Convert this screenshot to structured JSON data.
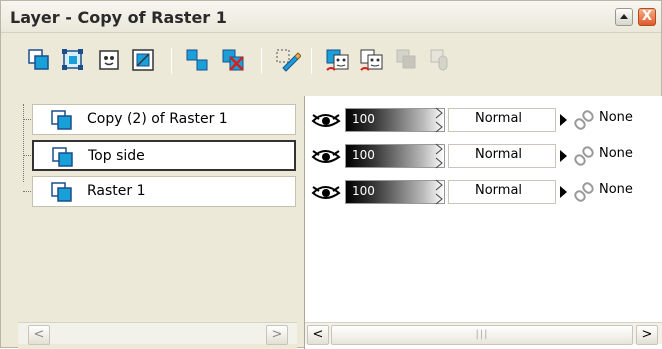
{
  "window": {
    "title": "Layer - Copy of Raster 1",
    "minimize_icon": "up-triangle-icon",
    "close_label": "X"
  },
  "toolbar": {
    "tools": [
      "new-raster-layer-icon",
      "new-vector-layer-icon",
      "new-mask-layer-icon",
      "new-adjustment-layer-icon",
      "duplicate-layer-icon",
      "delete-layer-icon",
      "edit-selection-icon",
      "show-mask-icon",
      "hide-mask-icon",
      "merge-group-icon",
      "link-toggle-icon"
    ]
  },
  "layers": [
    {
      "name": "Copy (2) of Raster 1",
      "opacity": "100",
      "blend": "Normal",
      "mask": "None",
      "selected": false
    },
    {
      "name": "Top side",
      "opacity": "100",
      "blend": "Normal",
      "mask": "None",
      "selected": true
    },
    {
      "name": "Raster 1",
      "opacity": "100",
      "blend": "Normal",
      "mask": "None",
      "selected": false
    }
  ],
  "scroll": {
    "left_arrow": "<",
    "right_arrow": ">",
    "thumb_grip": "|||"
  },
  "colors": {
    "panel_bg": "#ece9d8",
    "layer_icon_blue": "#1aa0d8",
    "close_button": "#e05a2a"
  }
}
